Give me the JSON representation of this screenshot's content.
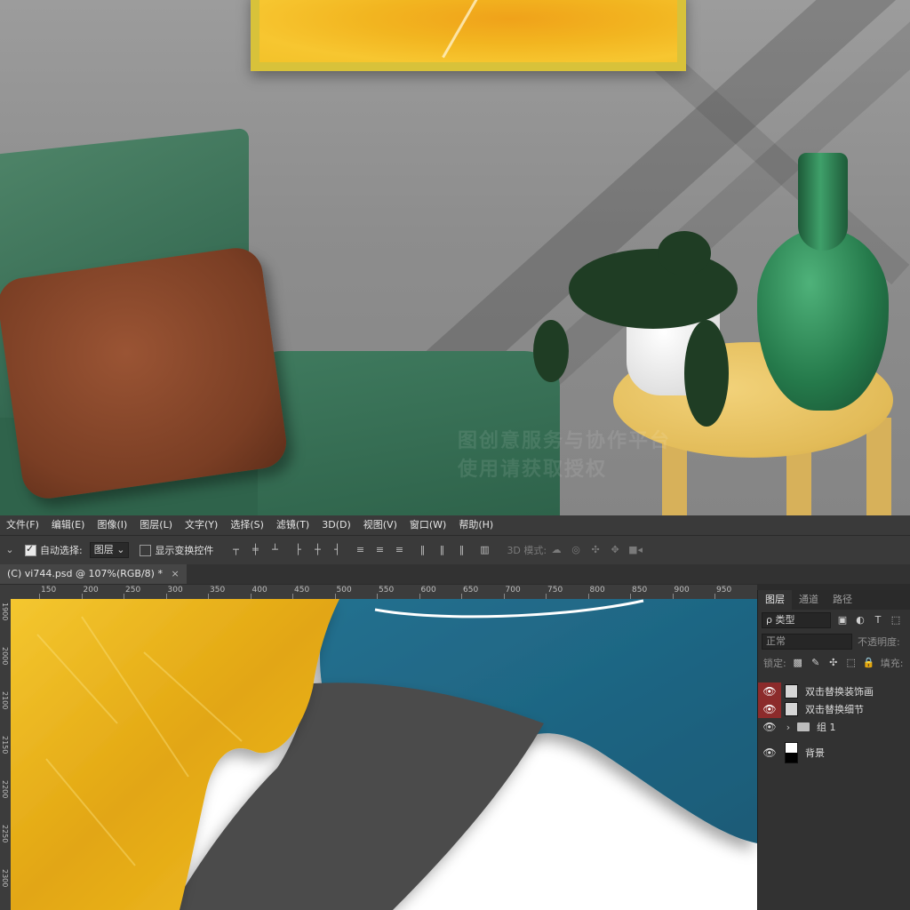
{
  "menu": [
    "文件(F)",
    "编辑(E)",
    "图像(I)",
    "图层(L)",
    "文字(Y)",
    "选择(S)",
    "滤镜(T)",
    "3D(D)",
    "视图(V)",
    "窗口(W)",
    "帮助(H)"
  ],
  "options": {
    "auto_select_label": "自动选择:",
    "auto_select_value": "图层",
    "show_transform_label": "显示变换控件",
    "mode_3d_label": "3D 模式:"
  },
  "document_tab": "(C) vi744.psd @ 107%(RGB/8) *",
  "ruler_h": [
    "150",
    "200",
    "250",
    "300",
    "350",
    "400",
    "450",
    "500",
    "550",
    "600",
    "650",
    "700",
    "750",
    "800",
    "850",
    "900",
    "950"
  ],
  "ruler_v": [
    "1900",
    "2000",
    "2100",
    "2150",
    "2200",
    "2250",
    "2300"
  ],
  "panel": {
    "tabs": [
      "图层",
      "通道",
      "路径"
    ],
    "filter_label": "ρ 类型",
    "blend_mode": "正常",
    "opacity_label": "不透明度:",
    "lock_label": "锁定:",
    "fill_label": "填充:"
  },
  "layers": [
    {
      "name": "双击替换装饰画",
      "type": "smart-object",
      "visible": true,
      "highlighted": true
    },
    {
      "name": "双击替换细节",
      "type": "smart-object",
      "visible": true,
      "highlighted": true
    },
    {
      "name": "组 1",
      "type": "group",
      "visible": true,
      "highlighted": false
    },
    {
      "name": "背景",
      "type": "background",
      "visible": true,
      "highlighted": false
    }
  ],
  "watermark": {
    "line1": "图创意服务与协作平台",
    "line2": "使用请获取授权"
  },
  "colors": {
    "gold": "#e7b21f",
    "teal": "#1f6784",
    "charcoal": "#4a4a4a",
    "eye_highlight": "#8c2b2b"
  }
}
